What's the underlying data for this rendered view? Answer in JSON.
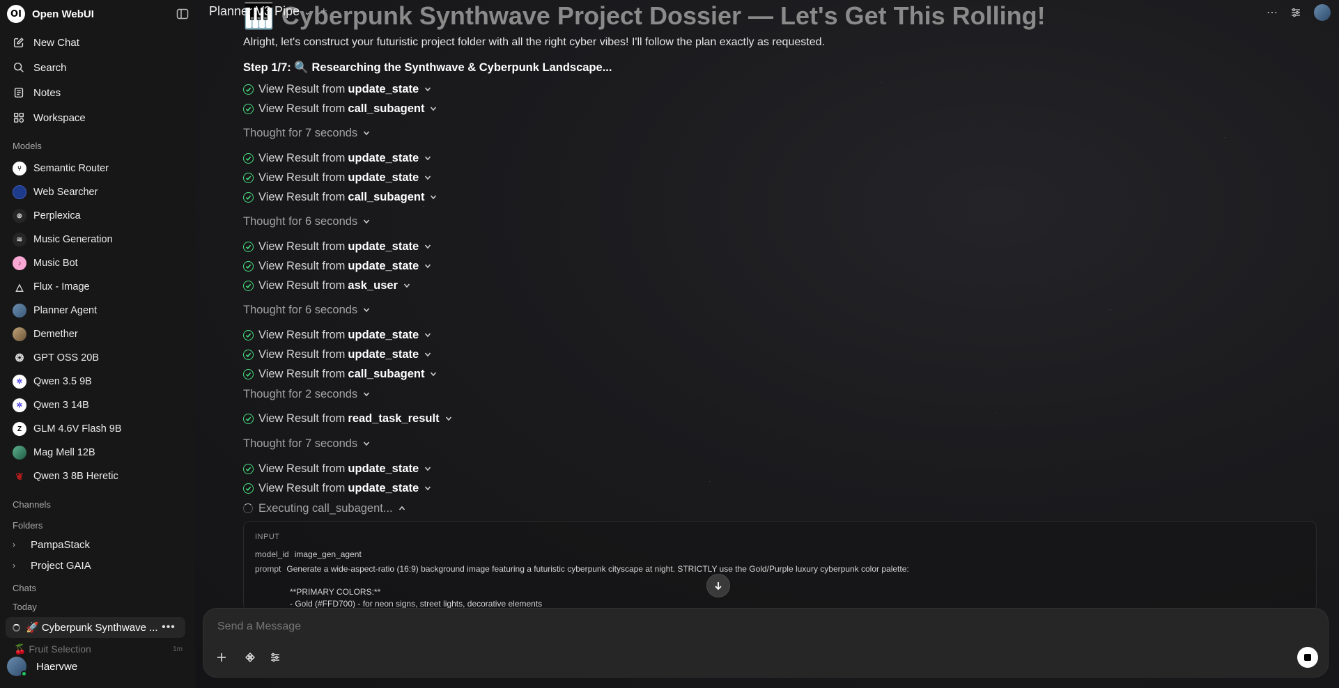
{
  "sidebar": {
    "app_name": "Open WebUI",
    "logo_text": "OI",
    "nav": {
      "new_chat": "New Chat",
      "search": "Search",
      "notes": "Notes",
      "workspace": "Workspace"
    },
    "models_label": "Models",
    "models": [
      {
        "label": "Semantic Router",
        "color": "#ffffff"
      },
      {
        "label": "Web Searcher",
        "color": "#1e3a8a"
      },
      {
        "label": "Perplexica",
        "color": "#2a2a2a"
      },
      {
        "label": "Music Generation",
        "color": "#2a2a2a"
      },
      {
        "label": "Music Bot",
        "color": "#f9a8d4"
      },
      {
        "label": "Flux - Image",
        "color": "#2a2a2a"
      },
      {
        "label": "Planner Agent",
        "color": "#4b6b8a"
      },
      {
        "label": "Demether",
        "color": "#8b7355"
      },
      {
        "label": "GPT OSS 20B",
        "color": "#2a2a2a"
      },
      {
        "label": "Qwen 3.5 9B",
        "color": "#ffffff"
      },
      {
        "label": "Qwen 3 14B",
        "color": "#ffffff"
      },
      {
        "label": "GLM 4.6V Flash 9B",
        "color": "#ffffff"
      },
      {
        "label": "Mag Mell 12B",
        "color": "#3b8a6b"
      },
      {
        "label": "Qwen 3 8B Heretic",
        "color": "#991b1b"
      }
    ],
    "channels_label": "Channels",
    "folders_label": "Folders",
    "folders": [
      "PampaStack",
      "Project GAIA"
    ],
    "chats_label": "Chats",
    "today_label": "Today",
    "chats": [
      {
        "title": "🚀 Cyberpunk Synthwave ...",
        "age": ""
      },
      {
        "title": "🍒 Fruit Selection",
        "age": "1m"
      }
    ],
    "user_name": "Haervwe"
  },
  "topbar": {
    "model_name": "Planner V3 Pipe"
  },
  "message": {
    "title": "🎹 Cyberpunk Synthwave Project Dossier — Let's Get This Rolling!",
    "intro": "Alright, let's construct your futuristic project folder with all the right cyber vibes! I'll follow the plan exactly as requested.",
    "step": "Step 1/7: 🔍 Researching the Synthwave & Cyberpunk Landscape...",
    "view_result_prefix": "View Result from",
    "results": [
      {
        "tool": "update_state"
      },
      {
        "tool": "call_subagent"
      },
      {
        "thought": "Thought for 7 seconds"
      },
      {
        "tool": "update_state"
      },
      {
        "tool": "update_state"
      },
      {
        "tool": "call_subagent"
      },
      {
        "thought": "Thought for 6 seconds"
      },
      {
        "tool": "update_state"
      },
      {
        "tool": "update_state"
      },
      {
        "tool": "ask_user"
      },
      {
        "thought": "Thought for 6 seconds"
      },
      {
        "tool": "update_state"
      },
      {
        "tool": "update_state"
      },
      {
        "tool": "call_subagent"
      },
      {
        "thought": "Thought for 2 seconds"
      },
      {
        "tool": "read_task_result"
      },
      {
        "thought": "Thought for 7 seconds"
      },
      {
        "tool": "update_state"
      },
      {
        "tool": "update_state"
      }
    ],
    "executing": "Executing call_subagent...",
    "io": {
      "label": "INPUT",
      "model_id_key": "model_id",
      "model_id_value": "image_gen_agent",
      "prompt_key": "prompt",
      "prompt_line1": "Generate a wide-aspect-ratio (16:9) background image featuring a futuristic cyberpunk cityscape at night. STRICTLY use the Gold/Purple luxury cyberpunk color palette:",
      "prompt_line2": "**PRIMARY COLORS:**",
      "prompt_line3": "- Gold (#FFD700) - for neon signs, street lights, decorative elements"
    }
  },
  "composer": {
    "placeholder": "Send a Message"
  },
  "colors": {
    "success": "#4ade80",
    "background": "#171717",
    "composer": "#262626"
  }
}
